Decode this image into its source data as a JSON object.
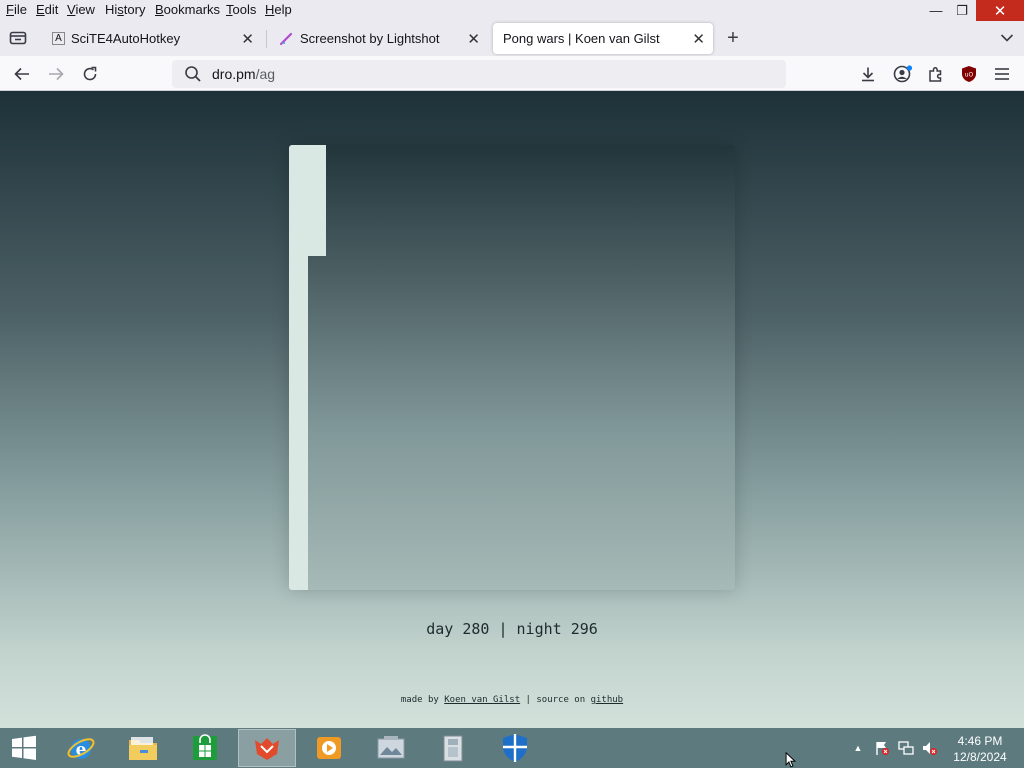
{
  "menu": {
    "items": [
      {
        "pre": "",
        "key": "F",
        "post": "ile"
      },
      {
        "pre": "",
        "key": "E",
        "post": "dit"
      },
      {
        "pre": "",
        "key": "V",
        "post": "iew"
      },
      {
        "pre": "Hi",
        "key": "s",
        "post": "tory"
      },
      {
        "pre": "",
        "key": "B",
        "post": "ookmarks"
      },
      {
        "pre": "",
        "key": "T",
        "post": "ools"
      },
      {
        "pre": "",
        "key": "H",
        "post": "elp"
      }
    ]
  },
  "window_controls": {
    "minimize": "—",
    "restore": "❐",
    "close": "✕"
  },
  "tabs": [
    {
      "title": "SciTE4AutoHotkey",
      "icon": "A",
      "icon_name": "autohotkey-icon",
      "close": "✕",
      "active": false
    },
    {
      "title": "Screenshot by Lightshot",
      "icon": "feather",
      "icon_name": "lightshot-icon",
      "close": "✕",
      "active": false
    },
    {
      "title": "Pong wars | Koen van Gilst",
      "icon": "",
      "icon_name": "",
      "close": "✕",
      "active": true
    }
  ],
  "new_tab_label": "+",
  "url": {
    "host": "dro.pm",
    "path": "/ag"
  },
  "page": {
    "score": {
      "day_label": "day",
      "day": "280",
      "separator": "|",
      "night_label": "night",
      "night": "296"
    },
    "footer": {
      "made_by": "made by",
      "author": "Koen van Gilst",
      "separator": "|",
      "source_on": "source on",
      "repo_link": "github"
    },
    "colors": {
      "day": "#d9e8e3",
      "night": "#22353b"
    }
  },
  "taskbar": {
    "items": [
      {
        "name": "start-button",
        "icon": "windows-logo"
      },
      {
        "name": "internet-explorer",
        "icon": "ie-icon"
      },
      {
        "name": "file-explorer",
        "icon": "folder-icon"
      },
      {
        "name": "store",
        "icon": "store-icon"
      },
      {
        "name": "browser-app",
        "icon": "firefox-icon",
        "active": true
      },
      {
        "name": "media-player",
        "icon": "media-icon"
      },
      {
        "name": "image-viewer",
        "icon": "photo-icon"
      },
      {
        "name": "archive-app",
        "icon": "archive-icon"
      },
      {
        "name": "defender",
        "icon": "shield-icon"
      }
    ],
    "clock": {
      "time": "4:46 PM",
      "date": "12/8/2024"
    },
    "tray_expand": "▲"
  }
}
